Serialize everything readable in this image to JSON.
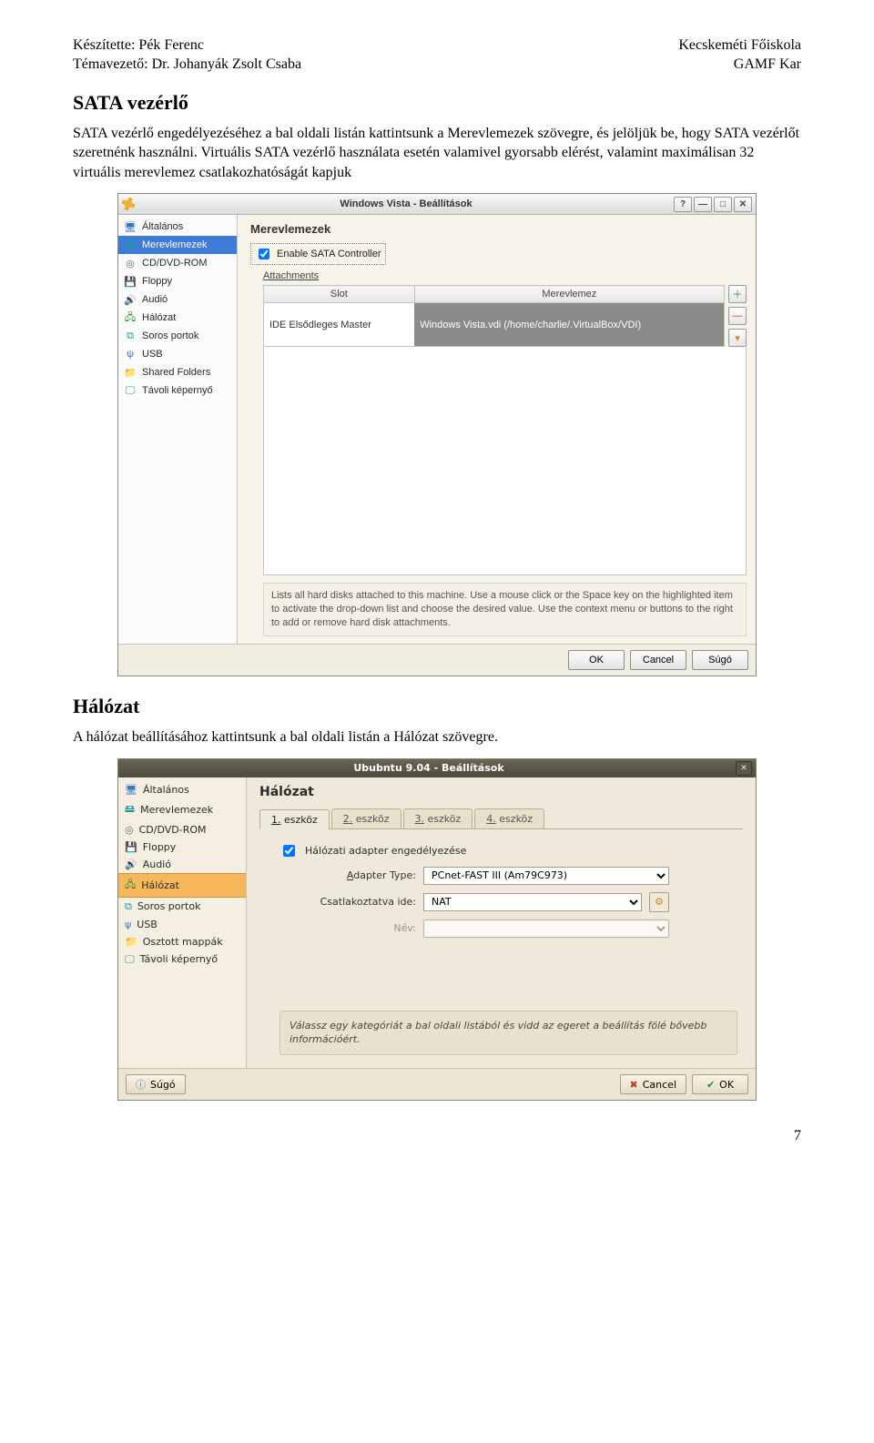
{
  "header": {
    "left_line1": "Készítette: Pék Ferenc",
    "left_line2": "Témavezető: Dr. Johanyák Zsolt Csaba",
    "right_line1": "Kecskeméti Főiskola",
    "right_line2": "GAMF Kar"
  },
  "section1": {
    "title": "SATA vezérlő",
    "paragraph": "SATA vezérlő engedélyezéséhez a bal oldali listán kattintsunk a Merevlemezek szövegre, és jelöljük be, hogy SATA vezérlőt szeretnénk használni. Virtuális SATA vezérlő használata esetén valamivel gyorsabb elérést, valamint maximálisan 32 virtuális merevlemez csatlakozhatóságát kapjuk"
  },
  "dlg1": {
    "title": "Windows Vista - Beállítások",
    "winbtns": {
      "help": "?",
      "min": "—",
      "max": "□",
      "close": "✕"
    },
    "sidebar": {
      "items": [
        {
          "label": "Általános",
          "icon": "🖥",
          "icon_name": "machine-icon"
        },
        {
          "label": "Merevlemezek",
          "icon": "🖴",
          "icon_name": "hdd-icon",
          "selected": true
        },
        {
          "label": "CD/DVD-ROM",
          "icon": "◎",
          "icon_name": "cd-icon"
        },
        {
          "label": "Floppy",
          "icon": "💾",
          "icon_name": "floppy-icon"
        },
        {
          "label": "Audió",
          "icon": "🔊",
          "icon_name": "audio-icon"
        },
        {
          "label": "Hálózat",
          "icon": "🖧",
          "icon_name": "network-icon"
        },
        {
          "label": "Soros portok",
          "icon": "⧉",
          "icon_name": "serial-icon"
        },
        {
          "label": "USB",
          "icon": "ψ",
          "icon_name": "usb-icon"
        },
        {
          "label": "Shared Folders",
          "icon": "📁",
          "icon_name": "folder-icon"
        },
        {
          "label": "Távoli képernyő",
          "icon": "🖵",
          "icon_name": "remote-icon"
        }
      ]
    },
    "main_heading": "Merevlemezek",
    "enable_sata_label": "Enable SATA Controller",
    "attachments_label": "Attachments",
    "table": {
      "headers": [
        "Slot",
        "Merevlemez"
      ],
      "rows": [
        {
          "slot": "IDE Elsődleges Master",
          "disk": "Windows Vista.vdi (/home/charlie/.VirtualBox/VDI)"
        }
      ]
    },
    "sidebtns": {
      "add": "＋",
      "remove": "—",
      "select": "▾"
    },
    "hint": "Lists all hard disks attached to this machine. Use a mouse click or the Space key on the highlighted item to activate the drop-down list and choose the desired value. Use the context menu or buttons to the right to add or remove hard disk attachments.",
    "footer": {
      "ok": "OK",
      "cancel": "Cancel",
      "help": "Súgó"
    }
  },
  "section2": {
    "title": "Hálózat",
    "paragraph": "A hálózat beállításához kattintsunk a bal oldali listán a Hálózat szövegre."
  },
  "dlg2": {
    "title": "Ububntu 9.04 - Beállítások",
    "close": "✕",
    "sidebar": {
      "items": [
        {
          "label": "Általános",
          "icon": "🖥",
          "icon_name": "machine-icon"
        },
        {
          "label": "Merevlemezek",
          "icon": "🖴",
          "icon_name": "hdd-icon"
        },
        {
          "label": "CD/DVD-ROM",
          "icon": "◎",
          "icon_name": "cd-icon"
        },
        {
          "label": "Floppy",
          "icon": "💾",
          "icon_name": "floppy-icon"
        },
        {
          "label": "Audió",
          "icon": "🔊",
          "icon_name": "audio-icon"
        },
        {
          "label": "Hálózat",
          "icon": "🖧",
          "icon_name": "network-icon",
          "selected": true
        },
        {
          "label": "Soros portok",
          "icon": "⧉",
          "icon_name": "serial-icon"
        },
        {
          "label": "USB",
          "icon": "ψ",
          "icon_name": "usb-icon"
        },
        {
          "label": "Osztott mappák",
          "icon": "📁",
          "icon_name": "folder-icon"
        },
        {
          "label": "Távoli képernyő",
          "icon": "🖵",
          "icon_name": "remote-icon"
        }
      ]
    },
    "main_heading": "Hálózat",
    "tabs": [
      "1. eszköz",
      "2. eszköz",
      "3. eszköz",
      "4. eszköz"
    ],
    "active_tab": 0,
    "enable_adapter_label": "Hálózati adapter engedélyezése",
    "enable_adapter_checked": true,
    "labels": {
      "adapter_type": "Adapter Type:",
      "attached_to": "Csatlakoztatva ide:",
      "name": "Név:"
    },
    "values": {
      "adapter_type": "PCnet-FAST III (Am79C973)",
      "attached_to": "NAT",
      "name": ""
    },
    "hint": "Válassz egy kategóriát a bal oldali listából és vidd az egeret a beállítás fölé bővebb információért.",
    "footer": {
      "help": "Súgó",
      "cancel": "Cancel",
      "ok": "OK",
      "icons": {
        "help": "ⓘ",
        "cancel": "✖",
        "ok": "✔"
      }
    }
  },
  "page_number": "7"
}
